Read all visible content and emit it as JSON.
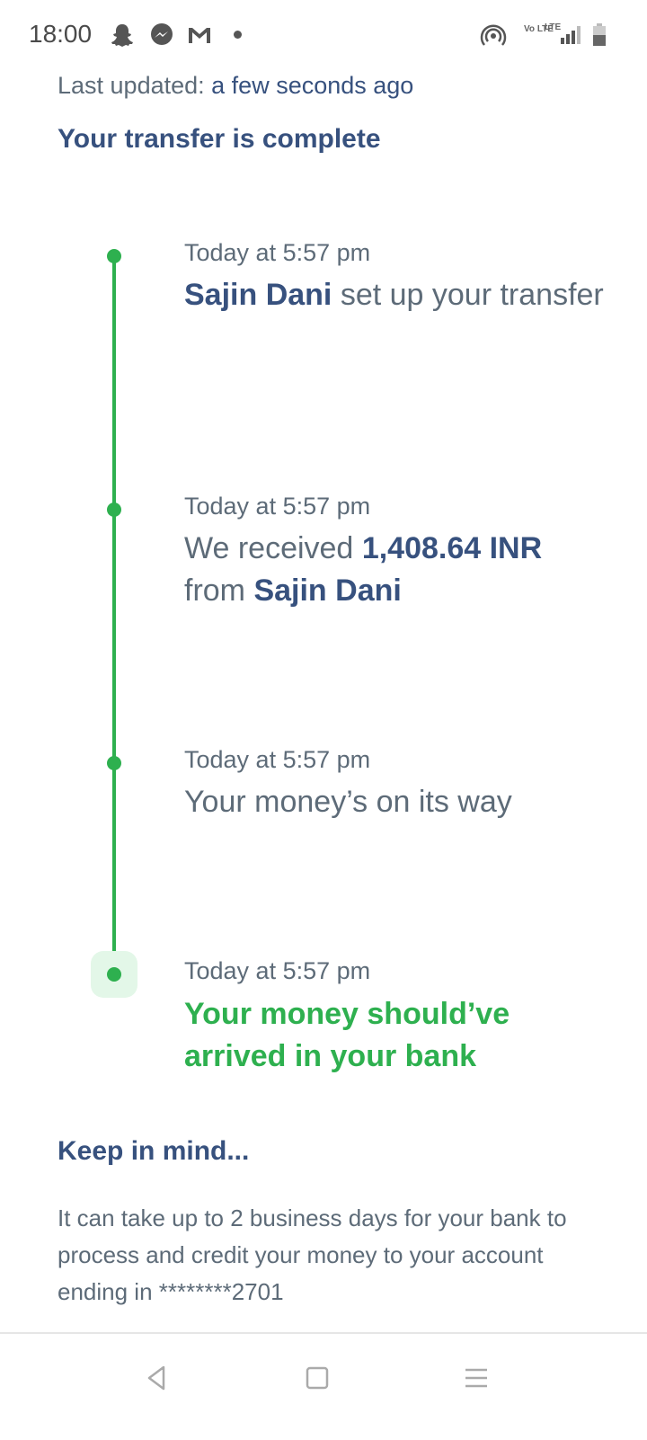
{
  "status_bar": {
    "time": "18:00",
    "icons": [
      "snapchat-icon",
      "messenger-icon",
      "gmail-icon",
      "notification-dot",
      "hotspot-icon",
      "volte-icon",
      "lte-signal-icon",
      "battery-icon"
    ],
    "volte_label": "Vo LTE",
    "lte_label": "LTE"
  },
  "header": {
    "last_updated_label": "Last updated:",
    "last_updated_value": "a few seconds ago",
    "status_title": "Your transfer is complete"
  },
  "timeline": [
    {
      "time": "Today at 5:57 pm",
      "name": "Sajin Dani",
      "text": "set up your transfer"
    },
    {
      "time": "Today at 5:57 pm",
      "text_before": "We received",
      "amount": "1,408.64 INR",
      "text_mid": "from",
      "name": "Sajin Dani"
    },
    {
      "time": "Today at 5:57 pm",
      "text": "Your money’s on its way"
    },
    {
      "time": "Today at 5:57 pm",
      "text": "Your money should’ve arrived in your bank"
    }
  ],
  "keep_in_mind": {
    "title": "Keep in mind...",
    "body": "It can take up to 2 business days for your bank to process and credit your money to your account ending in ********2701"
  },
  "nav": {
    "buttons": [
      "back-icon",
      "home-icon",
      "menu-icon"
    ]
  },
  "colors": {
    "accent_green": "#2eb04f",
    "navy": "#37517e",
    "text_gray": "#5d6b78"
  }
}
